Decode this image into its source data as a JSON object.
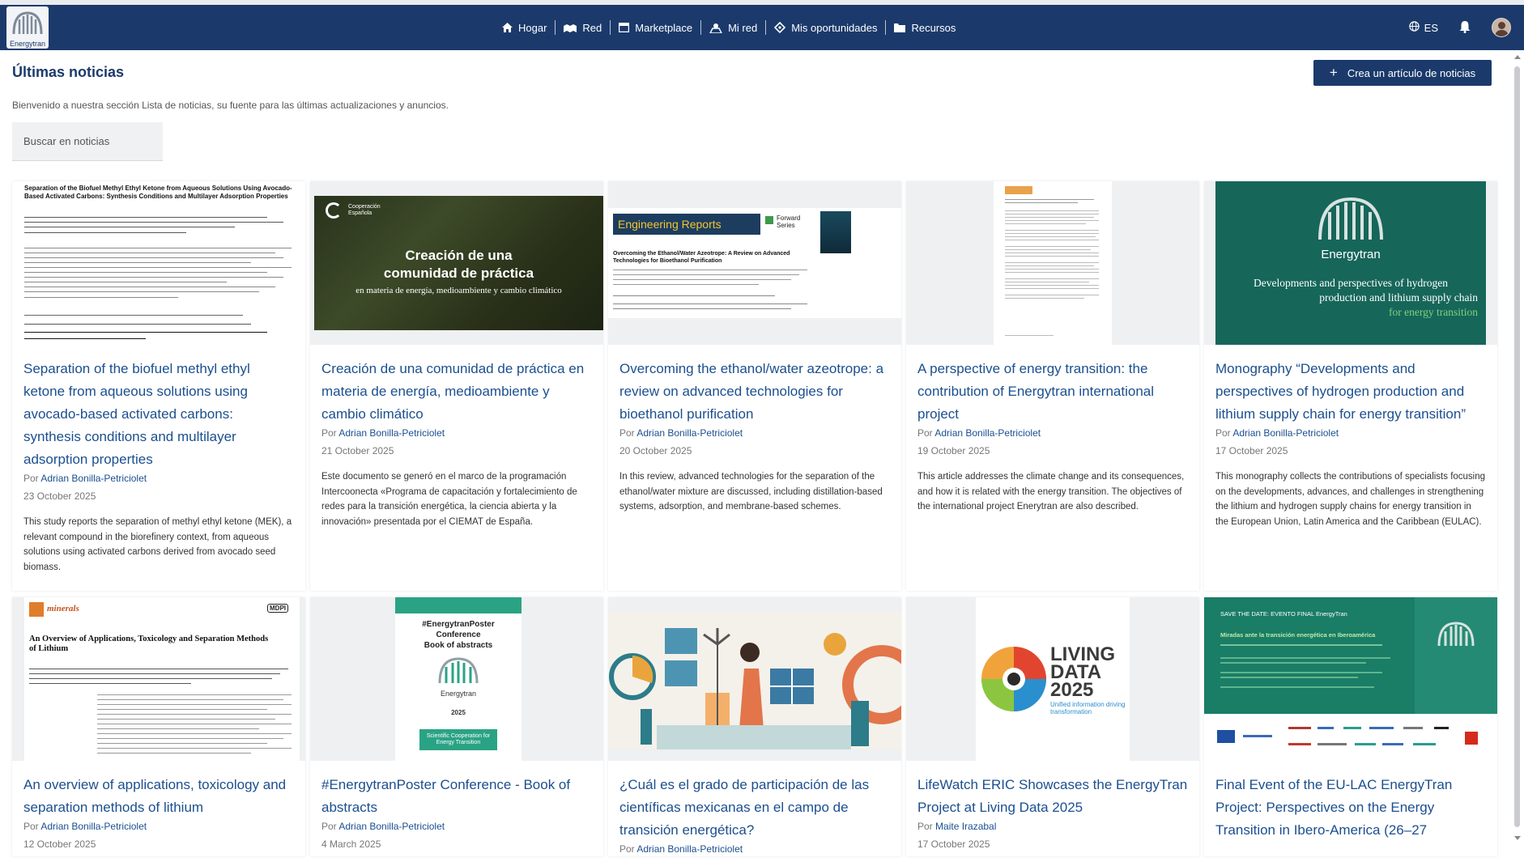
{
  "header": {
    "logo_text": "Energytran",
    "nav": [
      {
        "label": "Hogar",
        "icon": "home-icon"
      },
      {
        "label": "Red",
        "icon": "network-icon"
      },
      {
        "label": "Marketplace",
        "icon": "store-icon"
      },
      {
        "label": "Mi red",
        "icon": "group-icon"
      },
      {
        "label": "Mis oportunidades",
        "icon": "tag-icon"
      },
      {
        "label": "Recursos",
        "icon": "folder-icon"
      }
    ],
    "language": "ES"
  },
  "page": {
    "title": "Últimas noticias",
    "subtitle": "Bienvenido a nuestra sección Lista de noticias, su fuente para las últimas actualizaciones y anuncios.",
    "create_button": "Crea un artículo de noticias",
    "search_placeholder": "Buscar en noticias"
  },
  "colors": {
    "primary": "#1b3a6b",
    "link": "#1b4f8f",
    "teal": "#17665a"
  },
  "news": [
    {
      "title": "Separation of the biofuel methyl ethyl ketone from aqueous solutions using avocado-based activated carbons: synthesis conditions and multilayer adsorption properties",
      "by": "Por",
      "author": "Adrian Bonilla-Petriciolet",
      "date": "23 October 2025",
      "excerpt": "This study reports the separation of methyl ethyl ketone (MEK), a relevant compound in the biorefinery context, from aqueous solutions using activated carbons derived from avocado seed biomass.",
      "thumb_text": [
        "Separation of the Biofuel Methyl Ethyl Ketone from Aqueous Solutions Using Avocado-Based Activated Carbons: Synthesis Conditions and Multilayer Adsorption Properties"
      ]
    },
    {
      "title": "Creación de una comunidad de práctica en materia de energía, medioambiente y cambio climático",
      "by": "Por",
      "author": "Adrian Bonilla-Petriciolet",
      "date": "21 October 2025",
      "excerpt": "Este documento se generó en el marco de la programación Intercoonecta «Programa de capacitación y fortalecimiento de redes para la transición energética, la ciencia abierta y la innovación» presentada por el CIEMAT de España.",
      "thumb_text": [
        "Cooperación Española",
        "Creación de una",
        "comunidad de práctica",
        "en materia de energía, medioambiente y cambio climático"
      ]
    },
    {
      "title": "Overcoming the ethanol/water azeotrope: a review on advanced technologies for bioethanol purification",
      "by": "Por",
      "author": "Adrian Bonilla-Petriciolet",
      "date": "20 October 2025",
      "excerpt": "In this review, advanced technologies for the separation of the ethanol/water mixture are discussed, including distillation-based systems, adsorption, and membrane-based schemes.",
      "thumb_text": [
        "Engineering Reports",
        "Forward Series",
        "Overcoming the Ethanol/Water Azeotrope: A Review on Advanced Technologies for Bioethanol Purification"
      ]
    },
    {
      "title": "A perspective of energy transition: the contribution of Energytran international project",
      "by": "Por",
      "author": "Adrian Bonilla-Petriciolet",
      "date": "19 October 2025",
      "excerpt": "This article addresses the climate change and its consequences, and how it is related with the energy transition. The objectives of the international project Enerytran are also described.",
      "thumb_text": []
    },
    {
      "title": "Monography “Developments and perspectives of hydrogen production and lithium supply chain for energy transition”",
      "by": "Por",
      "author": "Adrian Bonilla-Petriciolet",
      "date": "17 October 2025",
      "excerpt": "This monography collects the contributions of specialists focusing on the developments, advances, and challenges in strengthening the lithium and hydrogen supply chains for energy transition in the European Union, Latin America and the Caribbean (EULAC).",
      "thumb_text": [
        "Energytran",
        "Developments and perspectives of hydrogen",
        "production and lithium supply chain",
        "for energy transition"
      ]
    },
    {
      "title": "An overview of applications, toxicology and separation methods of lithium",
      "by": "Por",
      "author": "Adrian Bonilla-Petriciolet",
      "date": "12 October 2025",
      "thumb_text": [
        "minerals",
        "MDPI",
        "An Overview of Applications, Toxicology and Separation Methods of Lithium"
      ]
    },
    {
      "title": "#EnergytranPoster Conference - Book of abstracts",
      "by": "Por",
      "author": "Adrian Bonilla-Petriciolet",
      "date": "4 March 2025",
      "thumb_text": [
        "#EnergytranPoster",
        "Conference",
        "Book of abstracts",
        "Energytran",
        "2025",
        "Scientific Cooperation for Energy Transition"
      ]
    },
    {
      "title": "¿Cuál es el grado de participación de las científicas mexicanas en el campo de transición energética?",
      "by": "Por",
      "author": "Adrian Bonilla-Petriciolet",
      "date": "",
      "thumb_text": []
    },
    {
      "title": "LifeWatch ERIC Showcases the EnergyTran Project at Living Data 2025",
      "by": "Por",
      "author": "Maite Irazabal",
      "date": "17 October 2025",
      "thumb_text": [
        "LIVING",
        "DATA",
        "2025",
        "Unified information driving transformation"
      ]
    },
    {
      "title": "Final Event of the EU-LAC EnergyTran Project: Perspectives on the Energy Transition in Ibero-America (26–27",
      "by": "",
      "author": "",
      "date": "",
      "thumb_text": [
        "SAVE THE DATE: EVENTO FINAL EnergyTran",
        "Miradas ante la transición energética en Iberoamérica"
      ]
    }
  ]
}
